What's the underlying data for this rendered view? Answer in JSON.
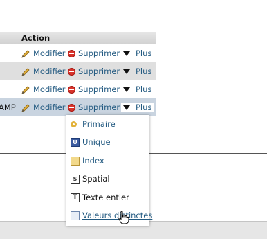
{
  "table": {
    "action_header": "Action",
    "rows": [
      {
        "lead": "",
        "modify": "Modifier",
        "delete": "Supprimer",
        "more": "Plus"
      },
      {
        "lead": "",
        "modify": "Modifier",
        "delete": "Supprimer",
        "more": "Plus"
      },
      {
        "lead": "",
        "modify": "Modifier",
        "delete": "Supprimer",
        "more": "Plus"
      },
      {
        "lead": "AMP",
        "modify": "Modifier",
        "delete": "Supprimer",
        "more": "Plus"
      }
    ]
  },
  "more_menu": {
    "items": [
      {
        "label": "Primaire",
        "icon": "key-icon"
      },
      {
        "label": "Unique",
        "icon": "unique-icon"
      },
      {
        "label": "Index",
        "icon": "index-icon"
      },
      {
        "label": "Spatial",
        "icon": "spatial-icon"
      },
      {
        "label": "Texte entier",
        "icon": "fulltext-icon"
      },
      {
        "label": "Valeurs distinctes",
        "icon": "distinct-values-icon"
      }
    ]
  },
  "colors": {
    "link": "#235a81",
    "row_alt": "#dfdfdf",
    "row_selected": "#c9d4e0",
    "delete_red": "#d9332b"
  }
}
